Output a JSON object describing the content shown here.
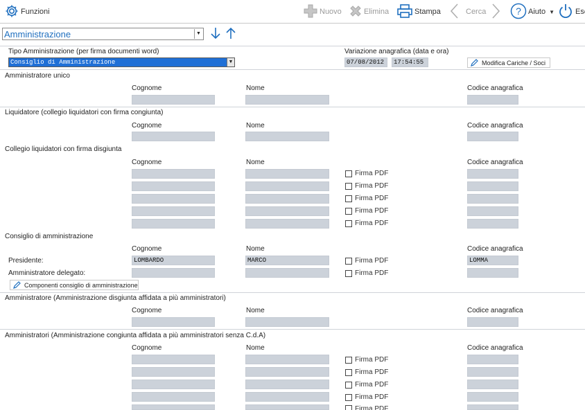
{
  "toolbar": {
    "funzioni": "Funzioni",
    "nuovo": "Nuovo",
    "elimina": "Elimina",
    "stampa": "Stampa",
    "cerca": "Cerca",
    "aiuto": "Aiuto",
    "esci": "Esc"
  },
  "nav": {
    "section": "Amministrazione"
  },
  "tipo": {
    "label": "Tipo Amministrazione (per firma documenti word)",
    "value": "Consiglio di Amministrazione"
  },
  "variazione": {
    "label": "Variazione anagrafica (data e ora)",
    "date": "07/08/2012",
    "time": "17:54:55",
    "button": "Modifica Cariche / Soci"
  },
  "columns": {
    "cognome": "Cognome",
    "nome": "Nome",
    "codice": "Codice anagrafica"
  },
  "sections": {
    "amm_unico": "Amministratore unico",
    "liquidatore": "Liquidatore (collegio liquidatori con firma congiunta)",
    "collegio": "Collegio liquidatori con firma disgiunta",
    "consiglio": "Consiglio di amministrazione",
    "amm_disgiunta": "Amministratore (Amministrazione disgiunta affidata a più amministratori)",
    "amm_congiunta": "Amministratori (Amministrazione congiunta affidata a più amministratori senza C.d.A)"
  },
  "firma_pdf": "Firma PDF",
  "consiglio": {
    "presidente_label": "Presidente:",
    "delegato_label": "Amministratore delegato:",
    "presidente_cognome": "LOMBARDO",
    "presidente_nome": "MARCO",
    "presidente_codice": "LOMMA",
    "componenti_button": "Componenti consiglio di amministrazione"
  },
  "colors": {
    "accent": "#1f6fbf",
    "field_bg": "#ccd2da",
    "selection": "#1f6fd6"
  }
}
